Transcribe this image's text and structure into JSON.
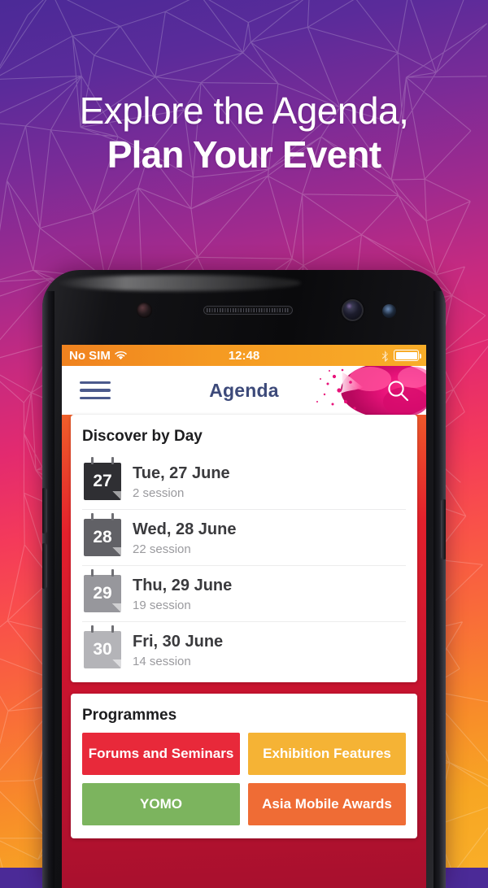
{
  "promo": {
    "headline_line1": "Explore the Agenda,",
    "headline_line2": "Plan Your Event"
  },
  "theme": {
    "bg_top": "#4b2a97",
    "bg_mid": "#e32a6f",
    "bg_bottom": "#f7a623",
    "nav_title_color": "#3d4a7a",
    "app_bg": "#e3202c"
  },
  "statusbar": {
    "carrier": "No SIM",
    "wifi_icon": "wifi-icon",
    "time": "12:48",
    "bluetooth_icon": "bluetooth-icon",
    "battery_icon": "battery-full-icon"
  },
  "navbar": {
    "menu_icon": "hamburger-menu-icon",
    "title": "Agenda",
    "search_icon": "search-icon"
  },
  "discover": {
    "title": "Discover by Day",
    "days": [
      {
        "date": "27",
        "label": "Tue, 27 June",
        "sessions": "2 session",
        "color": "#2f2f33"
      },
      {
        "date": "28",
        "label": "Wed, 28 June",
        "sessions": "22 session",
        "color": "#616166"
      },
      {
        "date": "29",
        "label": "Thu, 29 June",
        "sessions": "19 session",
        "color": "#97979c"
      },
      {
        "date": "30",
        "label": "Fri, 30 June",
        "sessions": "14 session",
        "color": "#b4b4b8"
      }
    ]
  },
  "programmes": {
    "title": "Programmes",
    "tiles": [
      {
        "label": "Forums and Seminars",
        "color": "#e8293a"
      },
      {
        "label": "Exhibition Features",
        "color": "#f5b335"
      },
      {
        "label": "YOMO",
        "color": "#7cb45e"
      },
      {
        "label": "Asia Mobile Awards",
        "color": "#ef6c35"
      }
    ]
  }
}
